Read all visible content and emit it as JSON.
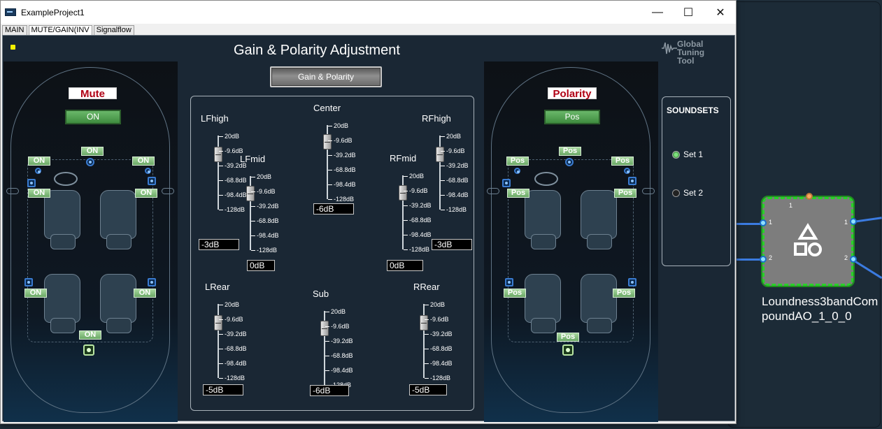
{
  "window": {
    "title": "ExampleProject1",
    "minimize": "—",
    "maximize": "☐",
    "close": "✕"
  },
  "tabs": [
    {
      "label": "MAIN"
    },
    {
      "label": "MUTE/GAIN(INV"
    },
    {
      "label": "Signalflow"
    }
  ],
  "page": {
    "title": "Gain & Polarity Adjustment",
    "center_button": "Gain & Polarity"
  },
  "logo": {
    "line1": "Global",
    "line2": "Tuning",
    "line3": "Tool"
  },
  "mute_panel": {
    "header": "Mute",
    "master": "ON",
    "toggles": {
      "center": "ON",
      "front_left_tweeter": "ON",
      "front_right_tweeter": "ON",
      "front_left_mid": "ON",
      "front_right_mid": "ON",
      "rear_left": "ON",
      "rear_right": "ON",
      "sub": "ON"
    }
  },
  "polarity_panel": {
    "header": "Polarity",
    "master": "Pos",
    "toggles": {
      "center": "Pos",
      "front_left_tweeter": "Pos",
      "front_right_tweeter": "Pos",
      "front_left_mid": "Pos",
      "front_right_mid": "Pos",
      "rear_left": "Pos",
      "rear_right": "Pos",
      "sub": "Pos"
    }
  },
  "fader_ticks": [
    "20dB",
    "-9.6dB",
    "-39.2dB",
    "-68.8dB",
    "-98.4dB",
    "-128dB"
  ],
  "faders": {
    "lfhigh": {
      "name": "LFhigh",
      "value": "-3dB"
    },
    "lfmid": {
      "name": "LFmid",
      "value": "0dB"
    },
    "center": {
      "name": "Center",
      "value": "-6dB"
    },
    "rfmid": {
      "name": "RFmid",
      "value": "0dB"
    },
    "rfhigh": {
      "name": "RFhigh",
      "value": "-3dB"
    },
    "lrear": {
      "name": "LRear",
      "value": "-5dB"
    },
    "sub": {
      "name": "Sub",
      "value": "-6dB"
    },
    "rrear": {
      "name": "RRear",
      "value": "-5dB"
    }
  },
  "soundsets": {
    "title": "SOUNDSETS",
    "options": [
      {
        "label": "Set 1",
        "selected": true
      },
      {
        "label": "Set 2",
        "selected": false
      }
    ]
  },
  "block": {
    "name": "Loundness3bandCompoundAO_1_0_0",
    "top_port": "1",
    "in1": "1",
    "in2": "2",
    "out1": "1",
    "out2": "2"
  }
}
